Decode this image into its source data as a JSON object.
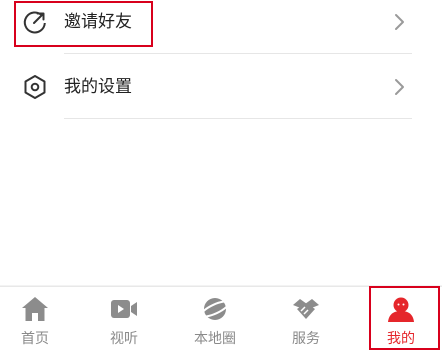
{
  "menu": {
    "items": [
      {
        "label": "邀请好友",
        "icon": "invite-share-icon"
      },
      {
        "label": "我的设置",
        "icon": "settings-hexagon-icon"
      }
    ],
    "chevron_icon": "chevron-right-icon"
  },
  "tabbar": {
    "tabs": [
      {
        "label": "首页",
        "icon": "home-icon",
        "active": false
      },
      {
        "label": "视听",
        "icon": "video-icon",
        "active": false
      },
      {
        "label": "本地圈",
        "icon": "planet-icon",
        "active": false
      },
      {
        "label": "服务",
        "icon": "handshake-icon",
        "active": false
      },
      {
        "label": "我的",
        "icon": "user-icon",
        "active": true
      }
    ],
    "inactive_color": "#8a8a8a",
    "active_color": "#e5262b"
  },
  "highlight_color": "#d8001c"
}
